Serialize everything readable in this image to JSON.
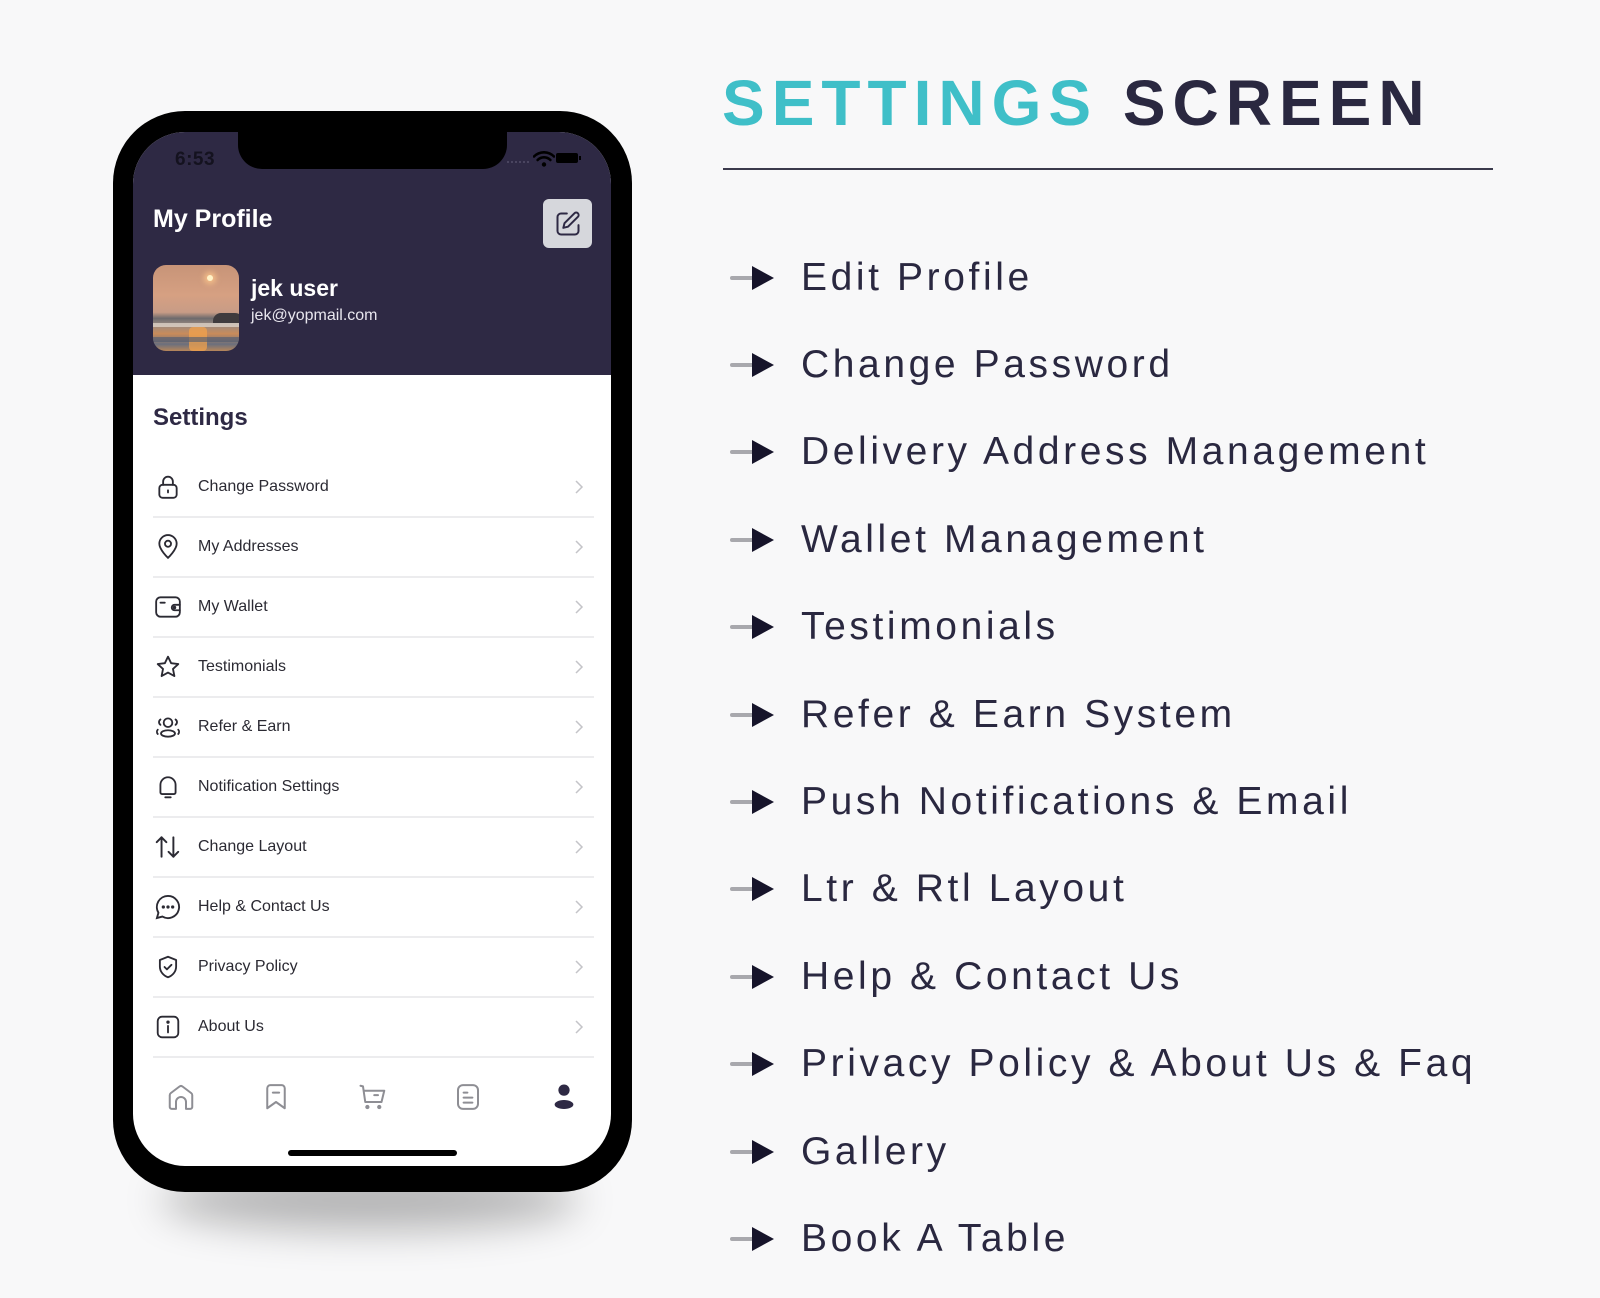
{
  "phone": {
    "status_bar": {
      "time": "6:53",
      "icons": [
        "signal-dots-icon",
        "wifi-icon",
        "battery-icon"
      ]
    },
    "header": {
      "title": "My Profile",
      "edit_button_icon": "edit-icon",
      "user": {
        "name": "jek user",
        "email": "jek@yopmail.com",
        "avatar": "sunset-beach-photo"
      },
      "background_color": "#2e2944"
    },
    "settings": {
      "title": "Settings",
      "items": [
        {
          "label": "Change Password",
          "icon": "lock-icon"
        },
        {
          "label": "My Addresses",
          "icon": "location-pin-icon"
        },
        {
          "label": "My Wallet",
          "icon": "wallet-icon"
        },
        {
          "label": "Testimonials",
          "icon": "star-icon"
        },
        {
          "label": "Refer & Earn",
          "icon": "users-icon"
        },
        {
          "label": "Notification Settings",
          "icon": "bell-icon"
        },
        {
          "label": "Change Layout",
          "icon": "arrows-up-down-icon"
        },
        {
          "label": "Help & Contact Us",
          "icon": "chat-bubble-icon"
        },
        {
          "label": "Privacy Policy",
          "icon": "shield-check-icon"
        },
        {
          "label": "About Us",
          "icon": "info-icon"
        }
      ]
    },
    "bottom_nav": [
      {
        "icon": "home-icon",
        "active": false
      },
      {
        "icon": "bookmark-icon",
        "active": false
      },
      {
        "icon": "cart-icon",
        "active": false
      },
      {
        "icon": "document-icon",
        "active": false
      },
      {
        "icon": "profile-icon",
        "active": true
      }
    ]
  },
  "hero": {
    "title_accent": "SETTINGS",
    "title_rest": "SCREEN",
    "accent_color": "#3fbfc8",
    "dark_color": "#2a2840"
  },
  "features": [
    "Edit Profile",
    "Change Password",
    "Delivery Address Management",
    "Wallet Management",
    "Testimonials",
    "Refer & Earn System",
    "Push Notifications & Email",
    "Ltr & Rtl Layout",
    "Help & Contact Us",
    "Privacy Policy & About Us & Faq",
    "Gallery",
    "Book A Table"
  ]
}
